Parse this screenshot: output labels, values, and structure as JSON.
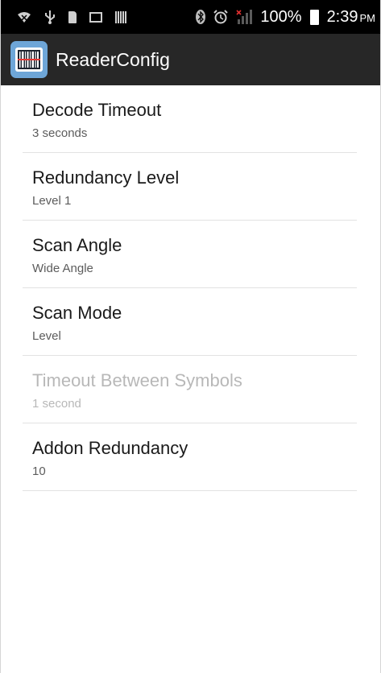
{
  "status_bar": {
    "battery_percent": "100%",
    "time": "2:39",
    "ampm": "PM"
  },
  "action_bar": {
    "title": "ReaderConfig"
  },
  "preferences": [
    {
      "title": "Decode Timeout",
      "summary": "3 seconds",
      "enabled": true
    },
    {
      "title": "Redundancy Level",
      "summary": "Level 1",
      "enabled": true
    },
    {
      "title": "Scan Angle",
      "summary": "Wide Angle",
      "enabled": true
    },
    {
      "title": "Scan Mode",
      "summary": "Level",
      "enabled": true
    },
    {
      "title": "Timeout Between Symbols",
      "summary": "1 second",
      "enabled": false
    },
    {
      "title": "Addon Redundancy",
      "summary": "10",
      "enabled": true
    }
  ],
  "colors": {
    "status_bar": "#000000",
    "action_bar": "#272727",
    "title_text": "#1a1a1a",
    "summary_text": "#5c5c5c",
    "disabled_text": "#b8b8b8",
    "divider": "#e2e2e2"
  }
}
